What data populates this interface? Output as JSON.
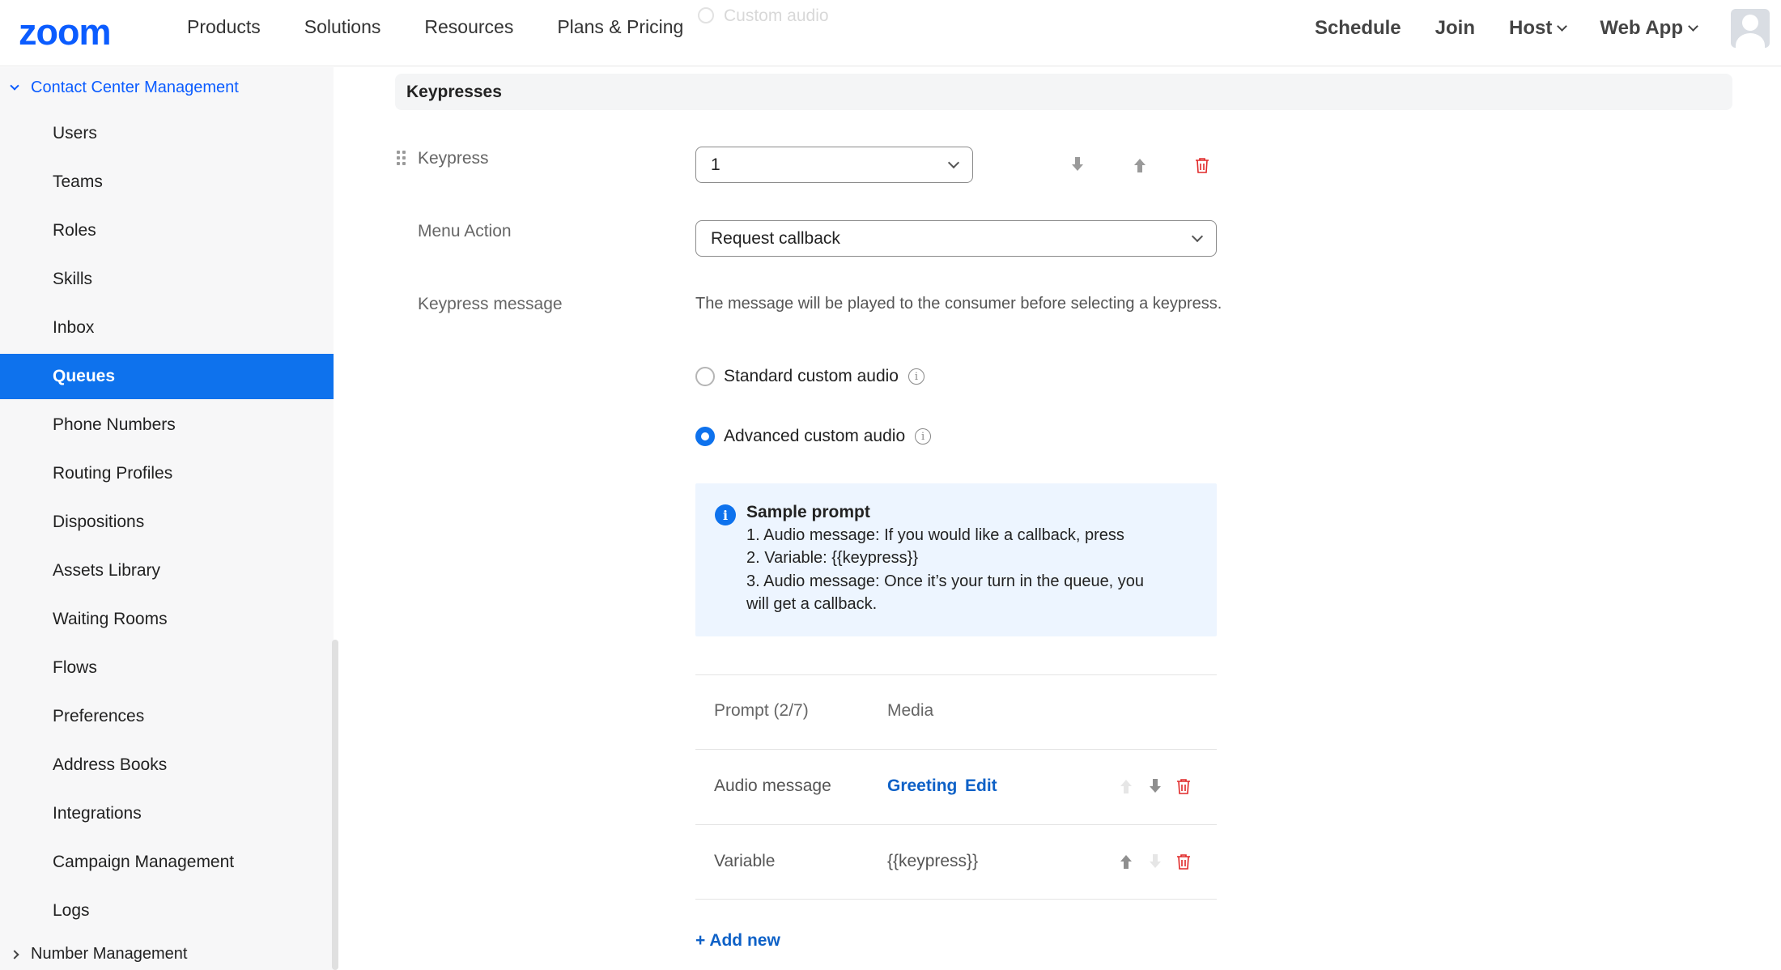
{
  "topnav": {
    "logo": "zoom",
    "links": [
      "Products",
      "Solutions",
      "Resources",
      "Plans & Pricing"
    ],
    "ghost_text": "Custom audio",
    "right_links": {
      "schedule": "Schedule",
      "join": "Join",
      "host": "Host",
      "web_app": "Web App"
    }
  },
  "sidebar": {
    "section": "Contact Center Management",
    "items": [
      {
        "label": "Users"
      },
      {
        "label": "Teams"
      },
      {
        "label": "Roles"
      },
      {
        "label": "Skills"
      },
      {
        "label": "Inbox"
      },
      {
        "label": "Queues",
        "active": true
      },
      {
        "label": "Phone Numbers"
      },
      {
        "label": "Routing Profiles"
      },
      {
        "label": "Dispositions"
      },
      {
        "label": "Assets Library"
      },
      {
        "label": "Waiting Rooms"
      },
      {
        "label": "Flows"
      },
      {
        "label": "Preferences"
      },
      {
        "label": "Address Books"
      },
      {
        "label": "Integrations"
      },
      {
        "label": "Campaign Management"
      },
      {
        "label": "Logs"
      }
    ],
    "footer_section": "Number Management"
  },
  "main": {
    "section_title": "Keypresses",
    "keypress_label": "Keypress",
    "keypress_value": "1",
    "menu_action_label": "Menu Action",
    "menu_action_value": "Request callback",
    "keypress_message_label": "Keypress message",
    "helper_text": "The message will be played to the consumer before selecting a keypress.",
    "radio_standard": "Standard custom audio",
    "radio_advanced": "Advanced custom audio",
    "selected_radio": "advanced",
    "sample": {
      "title": "Sample prompt",
      "lines": [
        "1. Audio message: If you would like a callback, press",
        "2. Variable: {{keypress}}",
        "3. Audio message: Once it’s your turn in the queue, you",
        "will get a callback."
      ]
    },
    "prompt_table": {
      "header_prompt": "Prompt (2/7)",
      "header_media": "Media",
      "rows": [
        {
          "prompt": "Audio message",
          "media_link": "Greeting",
          "media_action": "Edit"
        },
        {
          "prompt": "Variable",
          "media_text": "{{keypress}}"
        }
      ]
    },
    "add_new": "+ Add new"
  },
  "colors": {
    "brand": "#0b5cff",
    "active_nav": "#0e72ed",
    "link": "#0e61c7",
    "danger": "#e02828",
    "callout_bg": "#edf5ff"
  }
}
